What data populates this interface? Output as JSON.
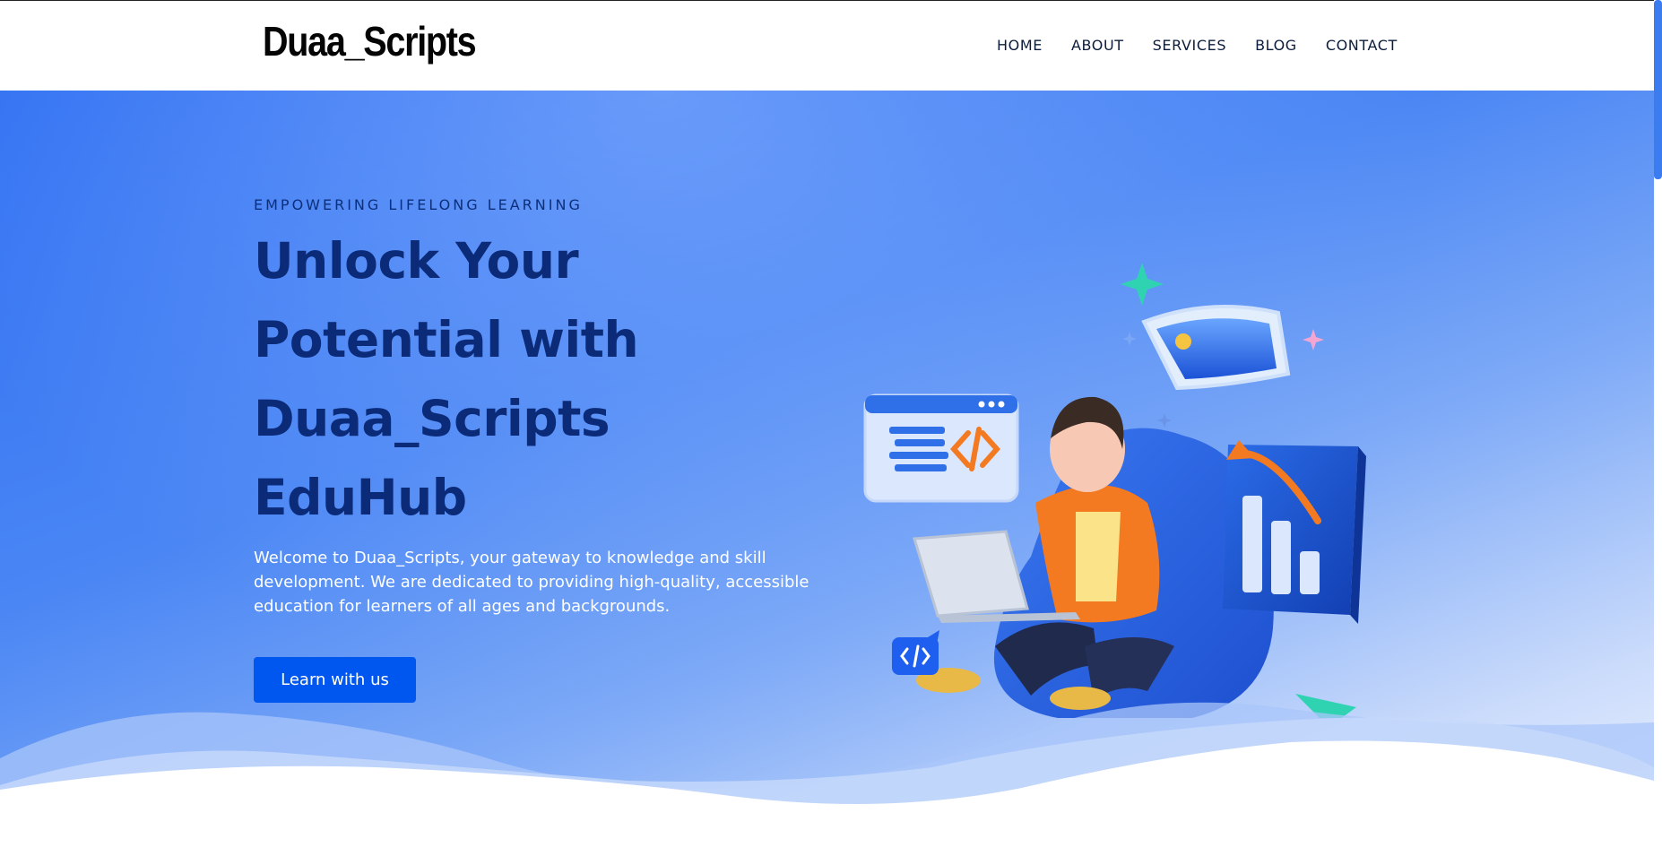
{
  "header": {
    "logo": "Duaa_Scripts",
    "nav": [
      "HOME",
      "ABOUT",
      "SERVICES",
      "BLOG",
      "CONTACT"
    ]
  },
  "hero": {
    "eyebrow": "EMPOWERING LIFELONG LEARNING",
    "headline_lines": [
      "Unlock Your",
      "Potential with",
      "Duaa_Scripts",
      "EduHub"
    ],
    "intro": "Welcome to Duaa_Scripts, your gateway to knowledge and skill development. We are dedicated to providing high-quality, accessible education for learners of all ages and backgrounds.",
    "cta_label": "Learn with us",
    "illustration_icon": "student-laptop-illustration"
  },
  "colors": {
    "accent": "#0057f0",
    "headline": "#0b2a78",
    "hero_start": "#2f6ff2",
    "hero_end": "#eef3ff",
    "orange": "#f47a22",
    "teal": "#2fd3b2"
  }
}
